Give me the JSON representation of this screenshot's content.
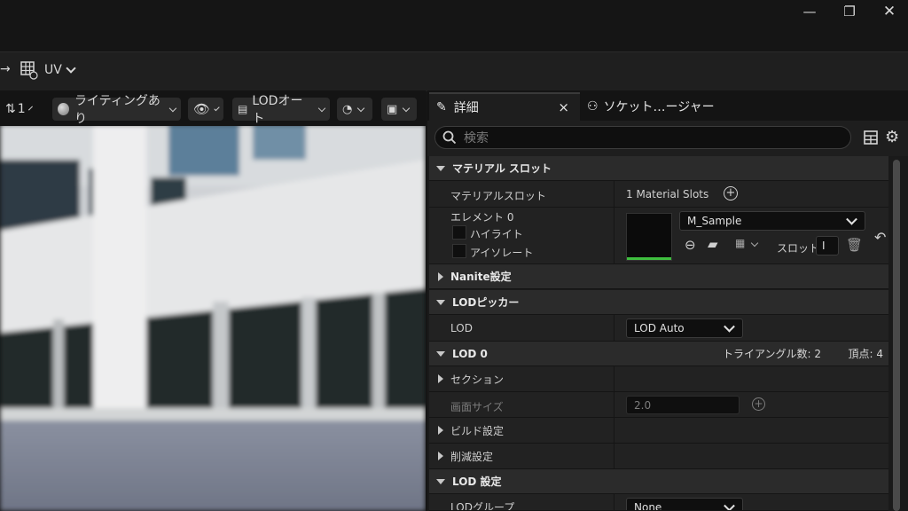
{
  "window": {
    "minimize": "—",
    "restore": "❐",
    "close": "✕"
  },
  "toolbar": {
    "arrow": "→",
    "uv_label": "UV"
  },
  "viewport_toolbar": {
    "camera_count": "1",
    "lighting": "ライティングあり",
    "lod": "LODオート"
  },
  "tabs": {
    "details": "詳細",
    "details_close": "×",
    "socket_manager": "ソケット…ージャー"
  },
  "search": {
    "placeholder": "検索"
  },
  "material_slots": {
    "header": "マテリアル スロット",
    "slots_label": "マテリアルスロット",
    "slots_value": "1 Material Slots",
    "element_label": "エレメント 0",
    "highlight": "ハイライト",
    "isolate": "アイソレート",
    "material_name": "M_Sample",
    "slot_label": "スロット",
    "slot_value": "I"
  },
  "nanite": {
    "header": "Nanite設定"
  },
  "lod_picker": {
    "header": "LODピッカー",
    "lod_label": "LOD",
    "lod_value": "LOD Auto"
  },
  "lod0": {
    "header": "LOD 0",
    "triangles": "トライアングル数: 2",
    "vertices": "頂点: 4",
    "sections": "セクション",
    "screen_size_label": "画面サイズ",
    "screen_size_value": "2.0",
    "build_settings": "ビルド設定",
    "reduction_settings": "削減設定"
  },
  "lod_settings": {
    "header": "LOD 設定",
    "lod_group_label": "LODグループ",
    "lod_group_value": "None"
  },
  "colors": {
    "accent_green": "#3fbf3f",
    "panel_bg": "#1a1a1a",
    "section_bg": "#2b2b2b"
  }
}
